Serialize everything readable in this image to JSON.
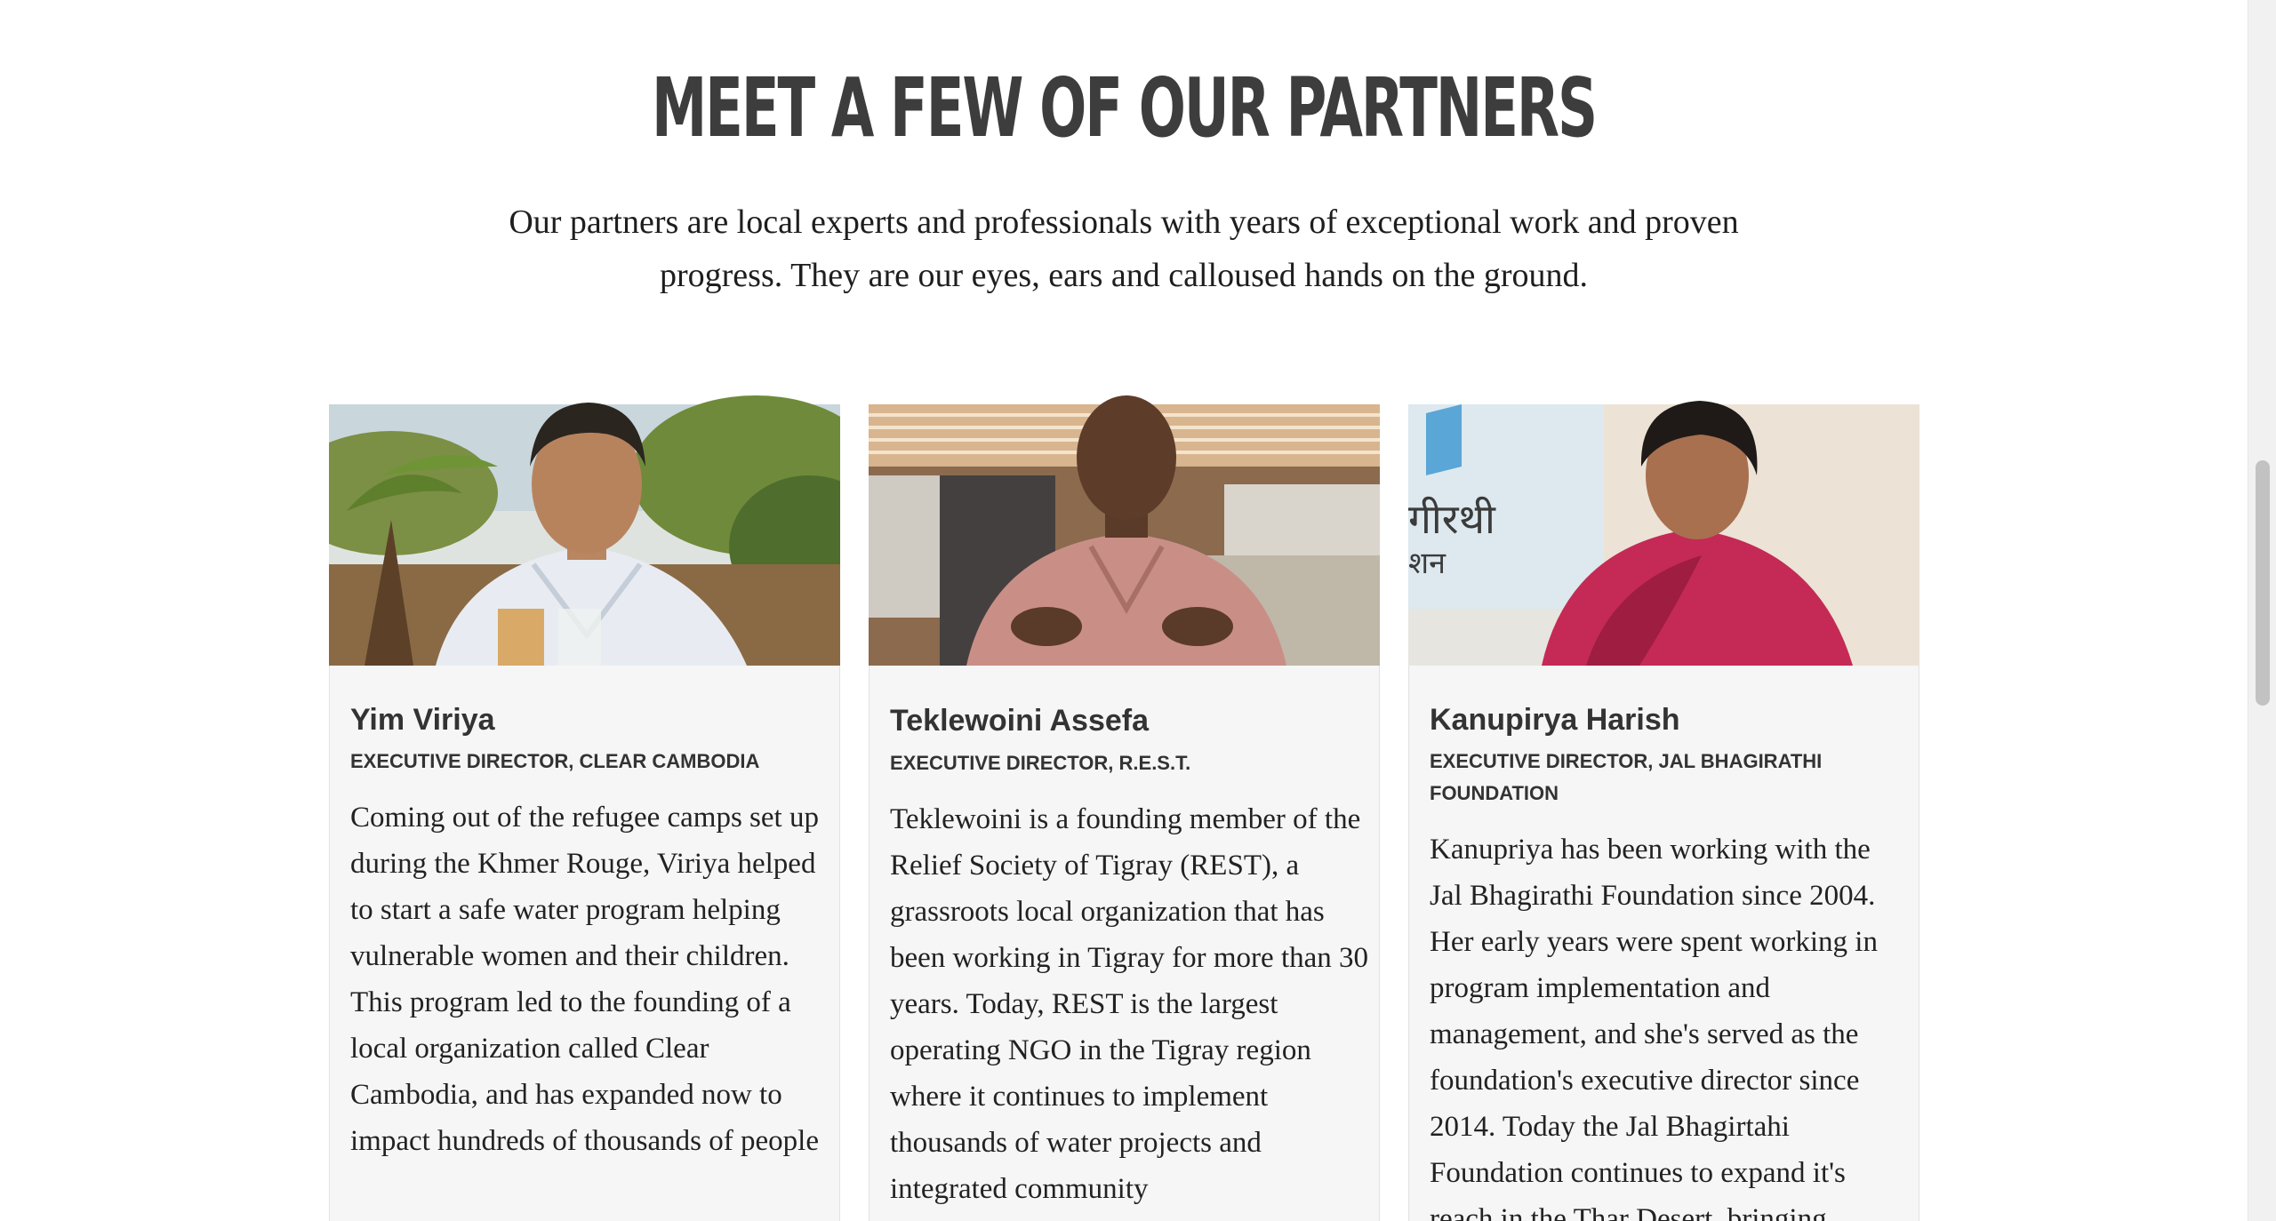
{
  "section": {
    "heading": "MEET A FEW OF OUR PARTNERS",
    "intro": "Our partners are local experts and professionals with years of exceptional work and proven progress. They are our eyes, ears and calloused hands on the ground."
  },
  "partners": [
    {
      "name": "Yim Viriya",
      "role": "EXECUTIVE DIRECTOR, CLEAR CAMBODIA",
      "bio": "Coming out of the refugee camps set up during the Khmer Rouge, Viriya helped to start a safe water program helping vulnerable women and their children. This program led to the founding of a local organization called Clear Cambodia, and has expanded now to impact hundreds of thousands of people"
    },
    {
      "name": "Teklewoini Assefa",
      "role": "EXECUTIVE DIRECTOR, R.E.S.T.",
      "bio": "Teklewoini is a founding member of the Relief Society of Tigray (REST), a grassroots local organization that has been working in Tigray for more than 30 years. Today, REST is the largest operating NGO in the Tigray region where it continues to implement thousands of water projects and integrated community"
    },
    {
      "name": "Kanupirya Harish",
      "role": "EXECUTIVE DIRECTOR, JAL BHAGIRATHI FOUNDATION",
      "bio": "Kanupriya has been working with the Jal Bhagirathi Foundation since 2004. Her early years were spent working in program implementation and management, and she's served as the foundation's executive director since 2014. Today the Jal Bhagirtahi Foundation continues to expand it's reach in the Thar Desert, bringing",
      "sign_text_1": "गीरथी",
      "sign_text_2": "शन"
    }
  ],
  "colors": {
    "heading": "#3d3d3d",
    "card_background": "#f6f6f6",
    "body_text": "#222222"
  }
}
